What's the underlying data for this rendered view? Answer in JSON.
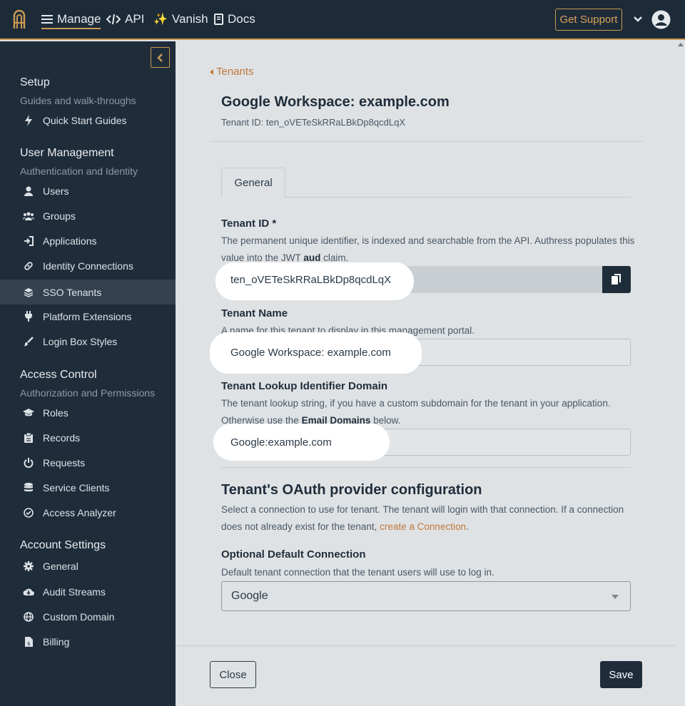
{
  "topbar": {
    "nav": [
      {
        "label": "Manage",
        "icon": "hamburger-icon"
      },
      {
        "label": "API",
        "icon": "code-icon"
      },
      {
        "label": "Vanish",
        "icon": "sparkles-icon"
      },
      {
        "label": "Docs",
        "icon": "book-icon"
      }
    ],
    "support_label": "Get Support",
    "accent": "#c99a52"
  },
  "sidebar": {
    "sections": [
      {
        "title": "Setup",
        "subtitle": "Guides and walk-throughs"
      },
      {
        "title": "User Management",
        "subtitle": "Authentication and Identity"
      },
      {
        "title": "Access Control",
        "subtitle": "Authorization and Permissions"
      },
      {
        "title": "Account Settings",
        "subtitle": ""
      }
    ],
    "items": [
      {
        "label": "Quick Start Guides",
        "icon": "bolt-icon"
      },
      {
        "label": "Users",
        "icon": "user-icon"
      },
      {
        "label": "Groups",
        "icon": "users-icon"
      },
      {
        "label": "Applications",
        "icon": "sign-in-icon"
      },
      {
        "label": "Identity Connections",
        "icon": "link-icon"
      },
      {
        "label": "SSO Tenants",
        "icon": "layers-icon"
      },
      {
        "label": "Platform Extensions",
        "icon": "plug-icon"
      },
      {
        "label": "Login Box Styles",
        "icon": "brush-icon"
      },
      {
        "label": "Roles",
        "icon": "graduation-cap-icon"
      },
      {
        "label": "Records",
        "icon": "clipboard-icon"
      },
      {
        "label": "Requests",
        "icon": "power-icon"
      },
      {
        "label": "Service Clients",
        "icon": "database-icon"
      },
      {
        "label": "Access Analyzer",
        "icon": "check-circle-icon"
      },
      {
        "label": "General",
        "icon": "gear-icon"
      },
      {
        "label": "Audit Streams",
        "icon": "cloud-download-icon"
      },
      {
        "label": "Custom Domain",
        "icon": "globe-icon"
      },
      {
        "label": "Billing",
        "icon": "invoice-icon"
      }
    ]
  },
  "main": {
    "back_label": "Tenants",
    "title": "Google Workspace: example.com",
    "subtitle": "Tenant ID: ten_oVETeSkRRaLBkDp8qcdLqX",
    "tab_general": "General",
    "tenant_id": {
      "label": "Tenant ID *",
      "desc_pre": "The permanent unique identifier, is indexed and searchable from the API. Authress populates this value into the JWT ",
      "desc_bold": "aud",
      "desc_post": " claim.",
      "value": "ten_oVETeSkRRaLBkDp8qcdLqX"
    },
    "tenant_name": {
      "label": "Tenant Name",
      "desc": "A name for this tenant to display in this management portal.",
      "value": "Google Workspace: example.com"
    },
    "lookup": {
      "label": "Tenant Lookup Identifier Domain",
      "desc_pre": "The tenant lookup string, if you have a custom subdomain for the tenant in your application. Otherwise use the ",
      "desc_bold": "Email Domains",
      "desc_post": " below.",
      "value": "Google:example.com"
    },
    "oauth": {
      "heading": "Tenant's OAuth provider configuration",
      "desc_pre": "Select a connection to use for tenant. The tenant will login with that connection. If a connection does not already exist for the tenant, ",
      "link": "create a Connection",
      "desc_post": "."
    },
    "connection": {
      "label": "Optional Default Connection",
      "desc": "Default tenant connection that the tenant users will use to log in.",
      "selected": "Google"
    },
    "close_label": "Close",
    "save_label": "Save"
  }
}
